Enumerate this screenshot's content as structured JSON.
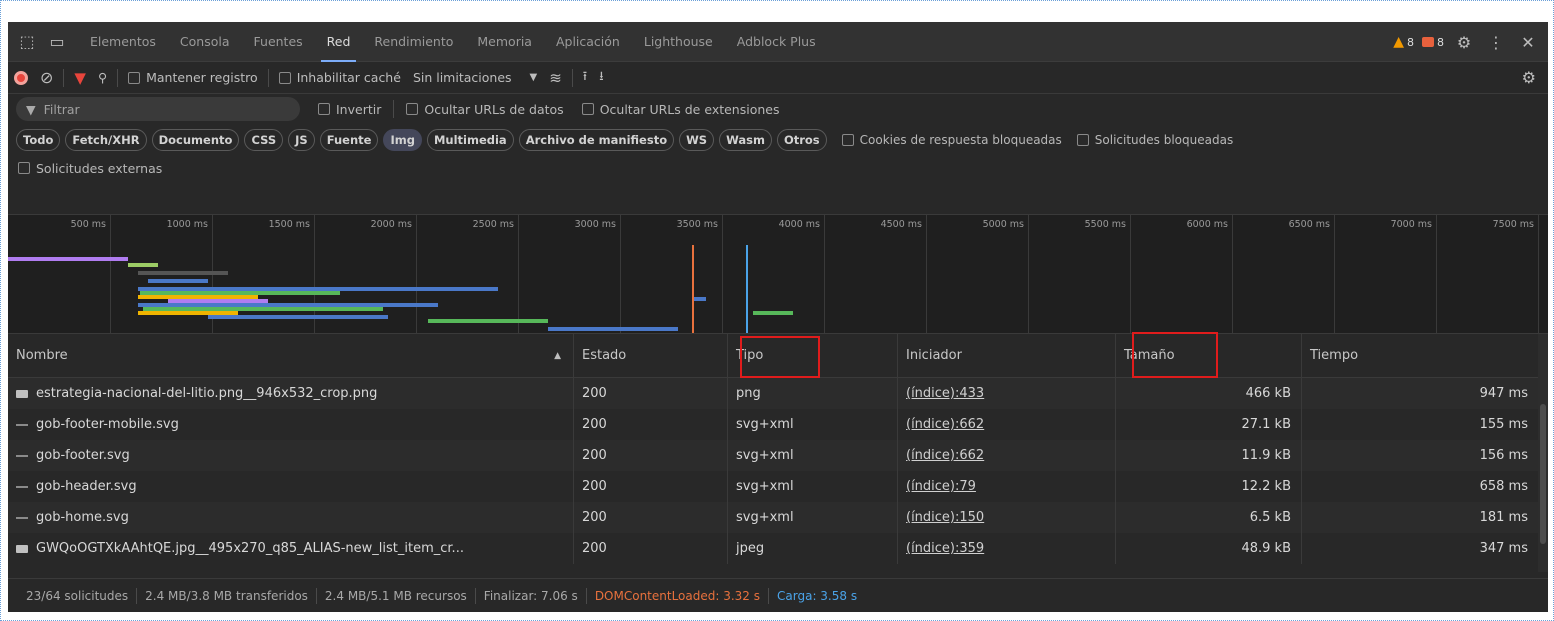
{
  "tabs": {
    "items": [
      "Elementos",
      "Consola",
      "Fuentes",
      "Red",
      "Rendimiento",
      "Memoria",
      "Aplicación",
      "Lighthouse",
      "Adblock Plus"
    ],
    "active_index": 3,
    "warnings_count": "8",
    "errors_count": "8"
  },
  "toolbar": {
    "preserve_log": "Mantener registro",
    "disable_cache": "Inhabilitar caché",
    "throttling": "Sin limitaciones"
  },
  "filter": {
    "placeholder": "Filtrar",
    "invert": "Invertir",
    "hide_data_urls": "Ocultar URLs de datos",
    "hide_extension_urls": "Ocultar URLs de extensiones"
  },
  "type_chips": [
    "Todo",
    "Fetch/XHR",
    "Documento",
    "CSS",
    "JS",
    "Fuente",
    "Img",
    "Multimedia",
    "Archivo de manifiesto",
    "WS",
    "Wasm",
    "Otros"
  ],
  "active_chip": "Img",
  "chip_options": {
    "blocked_cookies": "Cookies de respuesta bloqueadas",
    "blocked_requests": "Solicitudes bloqueadas"
  },
  "third_party": "Solicitudes externas",
  "timeline": {
    "ticks": [
      "500 ms",
      "1000 ms",
      "1500 ms",
      "2000 ms",
      "2500 ms",
      "3000 ms",
      "3500 ms",
      "4000 ms",
      "4500 ms",
      "5000 ms",
      "5500 ms",
      "6000 ms",
      "6500 ms",
      "7000 ms",
      "7500 ms"
    ]
  },
  "table": {
    "headers": {
      "name": "Nombre",
      "status": "Estado",
      "type": "Tipo",
      "initiator": "Iniciador",
      "size": "Tamaño",
      "time": "Tiempo"
    },
    "rows": [
      {
        "name": "estrategia-nacional-del-litio.png__946x532_crop.png",
        "status": "200",
        "type": "png",
        "initiator": "(índice):433",
        "size": "466 kB",
        "time": "947 ms",
        "icon": "image-file-icon"
      },
      {
        "name": "gob-footer-mobile.svg",
        "status": "200",
        "type": "svg+xml",
        "initiator": "(índice):662",
        "size": "27.1 kB",
        "time": "155 ms",
        "icon": "svg-file-icon"
      },
      {
        "name": "gob-footer.svg",
        "status": "200",
        "type": "svg+xml",
        "initiator": "(índice):662",
        "size": "11.9 kB",
        "time": "156 ms",
        "icon": "svg-file-icon"
      },
      {
        "name": "gob-header.svg",
        "status": "200",
        "type": "svg+xml",
        "initiator": "(índice):79",
        "size": "12.2 kB",
        "time": "658 ms",
        "icon": "svg-file-icon"
      },
      {
        "name": "gob-home.svg",
        "status": "200",
        "type": "svg+xml",
        "initiator": "(índice):150",
        "size": "6.5 kB",
        "time": "181 ms",
        "icon": "svg-file-icon"
      },
      {
        "name": "GWQoOGTXkAAhtQE.jpg__495x270_q85_ALIAS-new_list_item_cr...",
        "status": "200",
        "type": "jpeg",
        "initiator": "(índice):359",
        "size": "48.9 kB",
        "time": "347 ms",
        "icon": "image-file-icon"
      }
    ]
  },
  "status_bar": {
    "requests": "23/64 solicitudes",
    "transferred": "2.4 MB/3.8 MB transferidos",
    "resources": "2.4 MB/5.1 MB recursos",
    "finish": "Finalizar: 7.06 s",
    "dom_content_loaded": "DOMContentLoaded: 3.32 s",
    "load": "Carga: 3.58 s"
  },
  "colors": {
    "dom_content_loaded": "#e8713d",
    "load": "#4aa3e8",
    "highlight_box": "#e01c1c"
  }
}
